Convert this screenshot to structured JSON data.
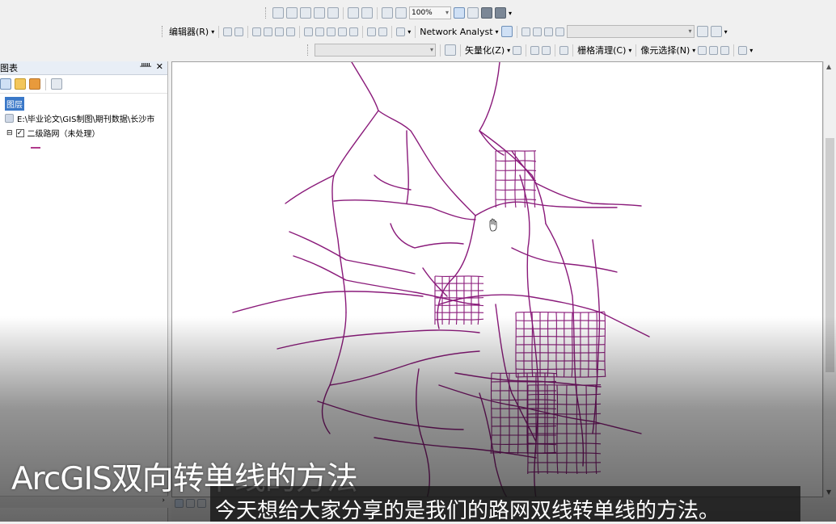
{
  "toolbar": {
    "zoom_value": "100%",
    "editor_menu": "编辑器(R)",
    "network_analyst": "Network Analyst",
    "vectorize_menu": "矢量化(Z)",
    "raster_cleanup": "栅格清理(C)",
    "cell_select": "像元选择(N)"
  },
  "toc": {
    "title": "图表",
    "layers_root": "图层",
    "data_path": "E:\\毕业论文\\GIS制图\\期刊数据\\长沙市",
    "layer_name": "二级路网（未处理）",
    "layer_checked": true,
    "legend_color": "#b03a8c"
  },
  "map": {
    "road_color": "#8a1a7a",
    "cursor": "hand-cursor"
  },
  "overlay": {
    "video_title": "ArcGIS双向转单线的方法",
    "subtitle": "今天想给大家分享的是我们的路网双线转单线的方法。"
  }
}
